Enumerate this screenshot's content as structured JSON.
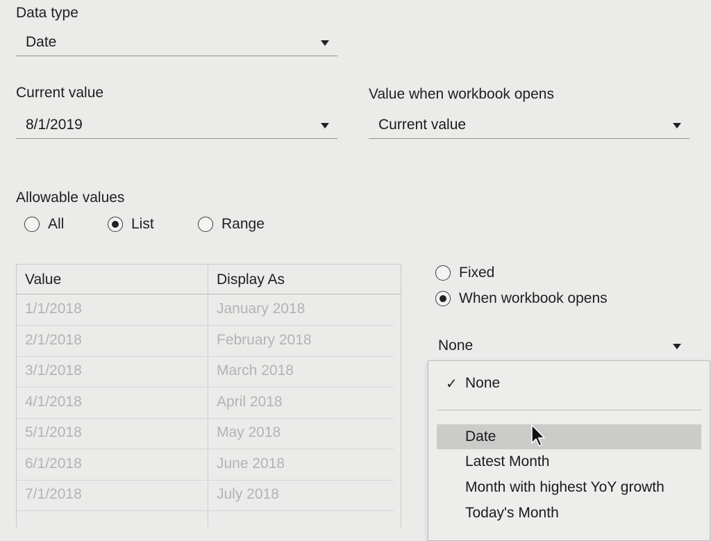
{
  "data_type": {
    "label": "Data type",
    "value": "Date"
  },
  "current_value": {
    "label": "Current value",
    "value": "8/1/2019"
  },
  "value_when_opens": {
    "label": "Value when workbook opens",
    "value": "Current value"
  },
  "allowable": {
    "label": "Allowable values",
    "options": [
      "All",
      "List",
      "Range"
    ],
    "selected": "List"
  },
  "table": {
    "headers": [
      "Value",
      "Display As"
    ],
    "rows": [
      [
        "1/1/2018",
        "January 2018"
      ],
      [
        "2/1/2018",
        "February 2018"
      ],
      [
        "3/1/2018",
        "March 2018"
      ],
      [
        "4/1/2018",
        "April 2018"
      ],
      [
        "5/1/2018",
        "May 2018"
      ],
      [
        "6/1/2018",
        "June 2018"
      ],
      [
        "7/1/2018",
        "July 2018"
      ]
    ]
  },
  "list_source": {
    "fixed_label": "Fixed",
    "opens_label": "When workbook opens",
    "selected": "When workbook opens"
  },
  "field_select": {
    "value": "None"
  },
  "field_menu": {
    "checked": "None",
    "items": [
      "None",
      "Date",
      "Latest Month",
      "Month with highest YoY growth",
      "Today's Month"
    ],
    "hovered": "Date"
  },
  "icons": {
    "caret": "caret-down-icon",
    "check": "check-icon",
    "cursor": "mouse-pointer-icon"
  }
}
